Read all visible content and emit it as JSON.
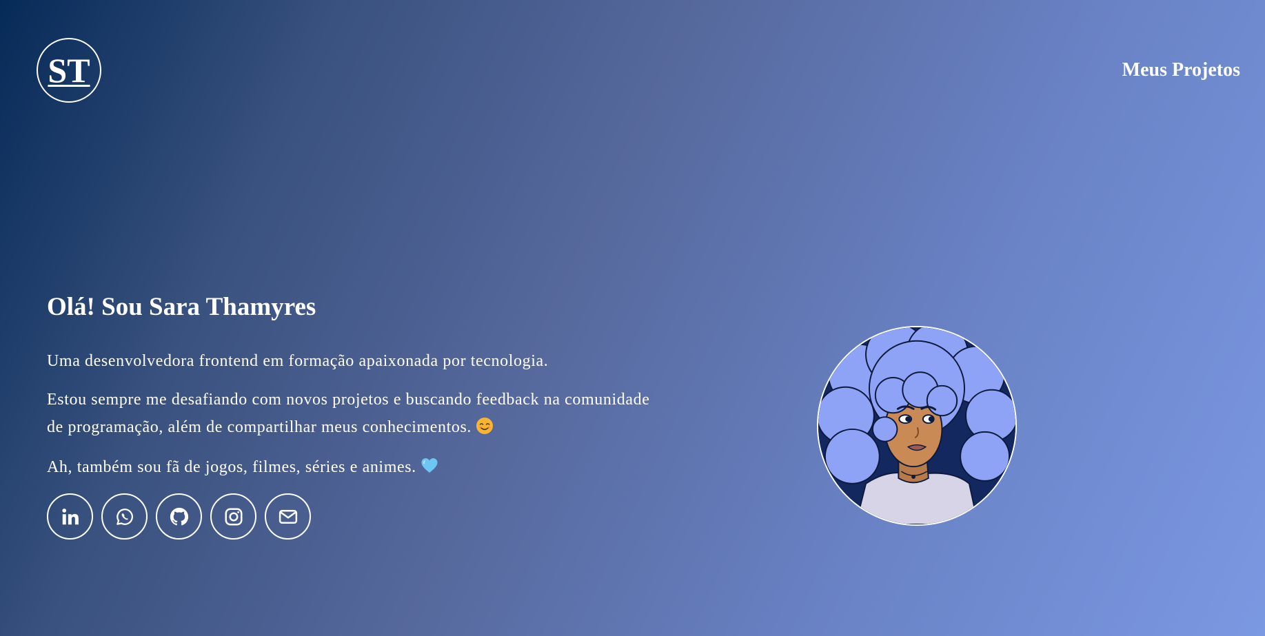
{
  "header": {
    "logo_text": "ST",
    "nav_link": "Meus Projetos"
  },
  "intro": {
    "title": "Olá! Sou Sara Thamyres",
    "paragraph_1": "Uma desenvolvedora frontend em formação apaixonada por tecnologia.",
    "paragraph_2": "Estou sempre me desafiando com novos projetos e buscando feedback na comunidade de programação, além de compartilhar meus conhecimentos.",
    "paragraph_3": "Ah, também sou fã de jogos, filmes, séries e animes."
  },
  "socials": [
    {
      "icon": "linkedin-icon"
    },
    {
      "icon": "whatsapp-icon"
    },
    {
      "icon": "github-icon"
    },
    {
      "icon": "instagram-icon"
    },
    {
      "icon": "email-icon"
    }
  ],
  "colors": {
    "gradient_start": "#062a57",
    "gradient_end": "#7b98e2",
    "hair": "#8ea3f5",
    "avatar_bg": "#13285e"
  }
}
